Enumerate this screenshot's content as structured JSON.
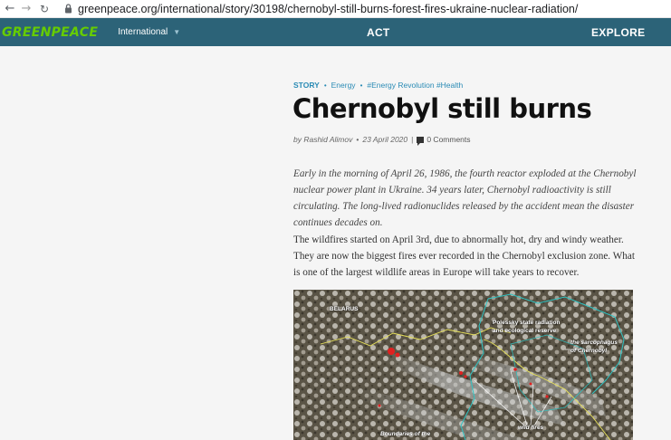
{
  "browser": {
    "url": "greenpeace.org/international/story/30198/chernobyl-still-burns-forest-fires-ukraine-nuclear-radiation/"
  },
  "site_nav": {
    "logo": "GREENPEACE",
    "region": "International",
    "act": "ACT",
    "explore": "EXPLORE"
  },
  "article": {
    "tags": {
      "story": "STORY",
      "energy": "Energy",
      "energy_revolution": "#Energy Revolution",
      "health": "#Health"
    },
    "title": "Chernobyl still burns",
    "author": "by Rashid Alimov",
    "date": "23 April 2020",
    "comments": "0 Comments",
    "lede": "Early in the morning of April 26, 1986, the fourth reactor exploded at the Chernobyl nuclear power plant in Ukraine. 34 years later, Chernobyl radioactivity is still circulating. The long-lived radionuclides released by the accident mean the disaster continues decades on.",
    "paragraph": "The wildfires started on April 3rd, due to abnormally hot, dry and windy weather. They are now the biggest fires ever recorded in the Chernobyl exclusion zone. What is one of the largest wildlife areas in Europe will take years to recover."
  },
  "map": {
    "belarus": "BELARUS",
    "reserve": "Polessky state radiation and ecological reserve",
    "sarcophagus": "the sarcophagus of Chernobyl",
    "wild_fires": "wild fires",
    "boundaries": "Boundaries of the"
  },
  "colors": {
    "nav_bg": "#2c6378",
    "logo_green": "#66cc00",
    "tag_blue": "#2a8bb5"
  }
}
